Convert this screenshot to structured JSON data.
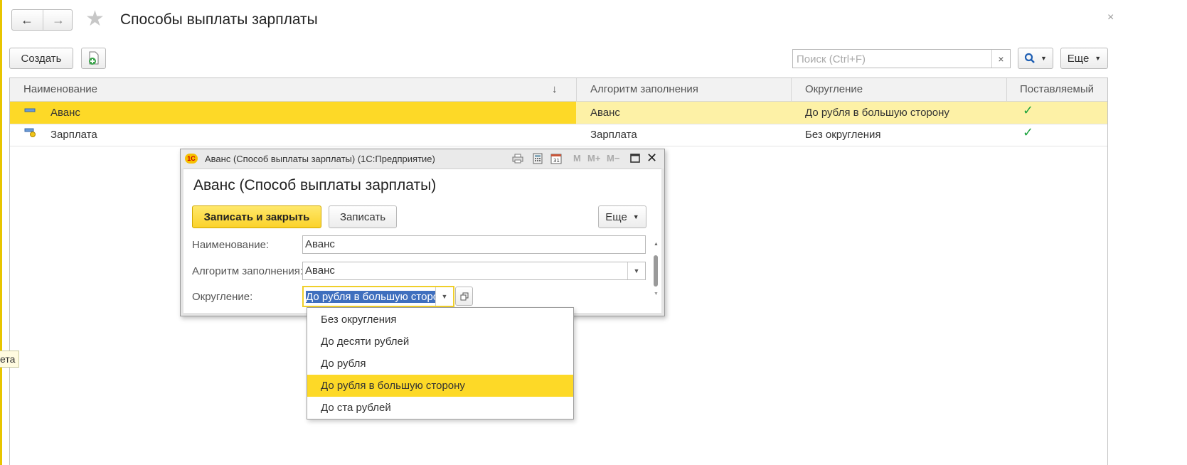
{
  "window": {
    "title": "Способы выплаты зарплаты",
    "back_icon": "arrow-left-icon",
    "forward_icon": "arrow-right-icon",
    "favorite_icon": "star-icon",
    "close_glyph": "×"
  },
  "toolbar": {
    "create_label": "Создать",
    "add_icon": "document-plus-icon",
    "search_placeholder": "Поиск (Ctrl+F)",
    "search_clear": "×",
    "search_icon": "magnifier-icon",
    "more_label": "Еще"
  },
  "table": {
    "columns": [
      "Наименование",
      "Алгоритм заполнения",
      "Округление",
      "Поставляемый"
    ],
    "sort_indicator": "↓",
    "rows": [
      {
        "name": "Аванс",
        "algorithm": "Аванс",
        "rounding": "До рубля в большую сторону",
        "supplied": "✓",
        "selected": true
      },
      {
        "name": "Зарплата",
        "algorithm": "Зарплата",
        "rounding": "Без округления",
        "supplied": "✓",
        "selected": false
      }
    ],
    "accent_color": "#fdd927",
    "check_color": "#19a23b"
  },
  "dialog": {
    "window_title": "Аванс (Способ выплаты зарплаты)  (1С:Предприятие)",
    "logo_text": "1С",
    "header": "Аванс (Способ выплаты зарплаты)",
    "save_close_label": "Записать и закрыть",
    "save_label": "Записать",
    "more_label": "Еще",
    "toolbar_icons": [
      "print-icon",
      "calculator-icon",
      "calendar-icon"
    ],
    "memory_buttons": [
      "M",
      "M+",
      "M−"
    ],
    "fields": {
      "name_label": "Наименование:",
      "name_value": "Аванс",
      "algorithm_label": "Алгоритм заполнения:",
      "algorithm_value": "Аванс",
      "rounding_label": "Округление:",
      "rounding_value": "До рубля в большую сторо"
    },
    "rounding_options": [
      "Без округления",
      "До десяти рублей",
      "До рубля",
      "До рубля в большую сторону",
      "До ста рублей"
    ],
    "highlighted_option_index": 3
  },
  "tooltip": {
    "text": "ета"
  }
}
